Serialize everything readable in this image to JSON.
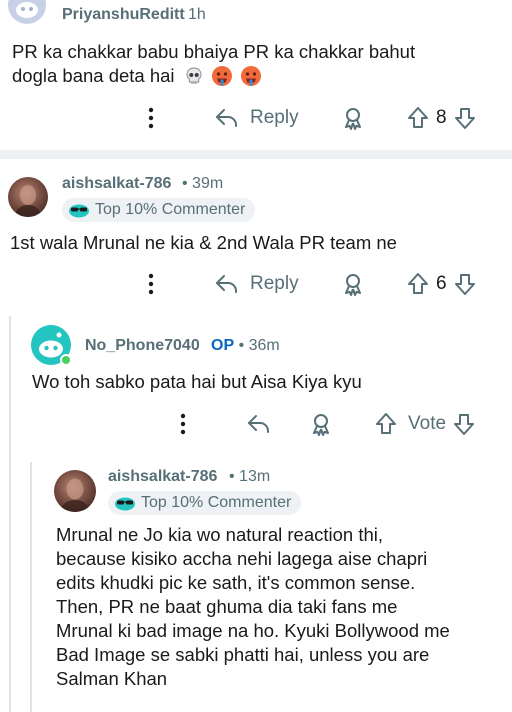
{
  "comments": [
    {
      "username": "PriyanshuReditt",
      "time": "1h",
      "text": "PR ka chakkar babu bhaiya PR ka chakkar bahut dogla bana deta hai",
      "emojis": [
        "skull",
        "hot-face",
        "hot-face"
      ],
      "reply_label": "Reply",
      "score": "8"
    },
    {
      "username": "aishsalkat-786",
      "time": "39m",
      "badge": "Top 10% Commenter",
      "text": "1st wala Mrunal ne kia & 2nd Wala PR team ne",
      "reply_label": "Reply",
      "score": "6"
    },
    {
      "username": "No_Phone7040",
      "op_label": "OP",
      "time": "36m",
      "text": "Wo toh sabko pata hai but Aisa Kiya kyu",
      "vote_label": "Vote"
    },
    {
      "username": "aishsalkat-786",
      "time": "13m",
      "badge": "Top 10% Commenter",
      "lines": [
        "Mrunal ne Jo kia wo natural reaction thi,",
        "because kisiko accha nehi lagega aise chapri",
        "edits khudki pic ke sath, it's common sense.",
        "Then, PR ne baat ghuma dia taki fans me",
        "Mrunal ki bad image na ho. Kyuki Bollywood me",
        "Bad Image se sabki phatti hai, unless you are",
        "Salman Khan"
      ]
    }
  ],
  "colors": {
    "meta": "#576f76",
    "op": "#0a66c2",
    "separator": "#edeff1",
    "snoo_avatar": "#24c5c0",
    "online": "#46d160"
  }
}
